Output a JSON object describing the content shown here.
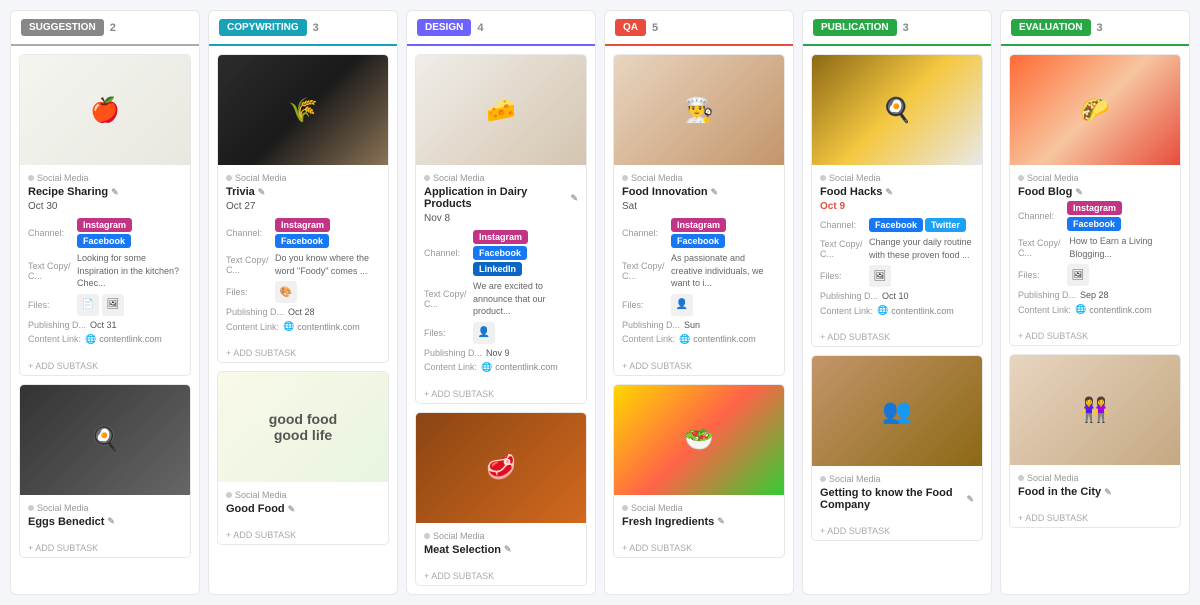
{
  "board": {
    "columns": [
      {
        "id": "suggestion",
        "label": "SUGGESTION",
        "labelClass": "badge-suggestion",
        "colClass": "col-suggestion",
        "count": "2",
        "cards": [
          {
            "id": "recipe-sharing",
            "imageClass": "img-recipe",
            "imageEmoji": "🍎",
            "category": "Social Media",
            "title": "Recipe Sharing",
            "dateClass": "normal",
            "date": "Oct 30",
            "channels": [
              "Instagram",
              "Facebook"
            ],
            "channelClasses": [
              "tag-instagram",
              "tag-facebook"
            ],
            "textCopy": "Looking for some Inspiration in the kitchen? Chec...",
            "files": [
              "📄",
              "🖼"
            ],
            "publishingDate": "Oct 31",
            "contentLink": "contentlink.com"
          },
          {
            "id": "card-2",
            "imageClass": "img-cooking",
            "imageEmoji": "🍳",
            "category": "Social Media",
            "title": "Eggs Benedict",
            "dateClass": "normal",
            "date": "",
            "channels": [],
            "channelClasses": [],
            "textCopy": "",
            "files": [],
            "publishingDate": "",
            "contentLink": ""
          }
        ]
      },
      {
        "id": "copywriting",
        "label": "COPYWRITING",
        "labelClass": "badge-copywriting",
        "colClass": "col-copywriting",
        "count": "3",
        "cards": [
          {
            "id": "trivia",
            "imageClass": "img-trivia",
            "imageEmoji": "🌾",
            "category": "Social Media",
            "title": "Trivia",
            "dateClass": "normal",
            "date": "Oct 27",
            "channels": [
              "Instagram",
              "Facebook"
            ],
            "channelClasses": [
              "tag-instagram",
              "tag-facebook"
            ],
            "textCopy": "Do you know where the word \"Foody\" comes ...",
            "files": [
              "🎨"
            ],
            "publishingDate": "Oct 28",
            "contentLink": "contentlink.com"
          },
          {
            "id": "card-cw2",
            "imageClass": "img-good-food",
            "imageEmoji": "",
            "imageText": "good food\ngood life",
            "category": "Social Media",
            "title": "Good Food",
            "dateClass": "normal",
            "date": "",
            "channels": [],
            "channelClasses": [],
            "textCopy": "",
            "files": [],
            "publishingDate": "",
            "contentLink": ""
          }
        ]
      },
      {
        "id": "design",
        "label": "DESIGN",
        "labelClass": "badge-design",
        "colClass": "col-design",
        "count": "4",
        "cards": [
          {
            "id": "dairy-products",
            "imageClass": "img-dairy",
            "imageEmoji": "🧀",
            "category": "Social Media",
            "title": "Application in Dairy Products",
            "dateClass": "normal",
            "date": "Nov 8",
            "channels": [
              "Instagram",
              "Facebook",
              "LinkedIn"
            ],
            "channelClasses": [
              "tag-instagram",
              "tag-facebook",
              "tag-linkedin"
            ],
            "textCopy": "We are excited to announce that our product...",
            "files": [
              "👤"
            ],
            "publishingDate": "Nov 9",
            "contentLink": "contentlink.com"
          },
          {
            "id": "card-d2",
            "imageClass": "img-meat",
            "imageEmoji": "🥩",
            "category": "Social Media",
            "title": "Meat Selection",
            "dateClass": "normal",
            "date": "",
            "channels": [],
            "channelClasses": [],
            "textCopy": "",
            "files": [],
            "publishingDate": "",
            "contentLink": ""
          }
        ]
      },
      {
        "id": "qa",
        "label": "QA",
        "labelClass": "badge-qa",
        "colClass": "col-qa",
        "count": "5",
        "cards": [
          {
            "id": "food-innovation",
            "imageClass": "img-food-innovation",
            "imageEmoji": "👨‍🍳",
            "category": "Social Media",
            "title": "Food Innovation",
            "dateClass": "normal",
            "date": "Sat",
            "channels": [
              "Instagram",
              "Facebook"
            ],
            "channelClasses": [
              "tag-instagram",
              "tag-facebook"
            ],
            "textCopy": "As passionate and creative individuals, we want to i...",
            "files": [
              "👤"
            ],
            "publishingDate": "Sun",
            "contentLink": "contentlink.com"
          },
          {
            "id": "card-qa2",
            "imageClass": "img-colorful",
            "imageEmoji": "🥗",
            "category": "Social Media",
            "title": "Fresh Ingredients",
            "dateClass": "normal",
            "date": "",
            "channels": [],
            "channelClasses": [],
            "textCopy": "",
            "files": [],
            "publishingDate": "",
            "contentLink": ""
          }
        ]
      },
      {
        "id": "publication",
        "label": "PUBLICATION",
        "labelClass": "badge-publication",
        "colClass": "col-publication",
        "count": "3",
        "cards": [
          {
            "id": "food-hacks",
            "imageClass": "img-food-hacks",
            "imageEmoji": "🍳",
            "category": "Social Media",
            "title": "Food Hacks",
            "dateClass": "overdue",
            "date": "Oct 9",
            "channels": [
              "Facebook",
              "Twitter"
            ],
            "channelClasses": [
              "tag-facebook",
              "tag-twitter"
            ],
            "textCopy": "Change your daily routine with these proven food ...",
            "files": [
              "🖼"
            ],
            "publishingDate": "Oct 10",
            "contentLink": "contentlink.com"
          },
          {
            "id": "card-pub2",
            "imageClass": "img-people",
            "imageEmoji": "👥",
            "category": "Social Media",
            "title": "Getting to know the Food Company",
            "dateClass": "normal",
            "date": "",
            "channels": [],
            "channelClasses": [],
            "textCopy": "",
            "files": [],
            "publishingDate": "",
            "contentLink": ""
          }
        ]
      },
      {
        "id": "evaluation",
        "label": "EVALUATION",
        "labelClass": "badge-evaluation",
        "colClass": "col-evaluation",
        "count": "3",
        "cards": [
          {
            "id": "food-blog",
            "imageClass": "img-food-blog",
            "imageEmoji": "🌮",
            "category": "Social Media",
            "title": "Food Blog",
            "dateClass": "normal",
            "date": "",
            "channels": [
              "Instagram",
              "Facebook"
            ],
            "channelClasses": [
              "tag-instagram",
              "tag-facebook"
            ],
            "textCopy": "How to Earn a Living Blogging...",
            "files": [
              "🖼"
            ],
            "publishingDate": "Sep 28",
            "contentLink": "contentlink.com"
          },
          {
            "id": "card-ev2",
            "imageClass": "img-friends",
            "imageEmoji": "👭",
            "category": "Social Media",
            "title": "Food in the City",
            "dateClass": "normal",
            "date": "",
            "channels": [],
            "channelClasses": [],
            "textCopy": "",
            "files": [],
            "publishingDate": "",
            "contentLink": ""
          }
        ]
      }
    ]
  },
  "labels": {
    "channel": "Channel:",
    "textCopy": "Text Copy/ C...",
    "files": "Files:",
    "publishingDate": "Publishing D...",
    "contentLink": "Content Link:",
    "addSubtask": "+ ADD SUBTASK",
    "socialMedia": "Social Media"
  }
}
